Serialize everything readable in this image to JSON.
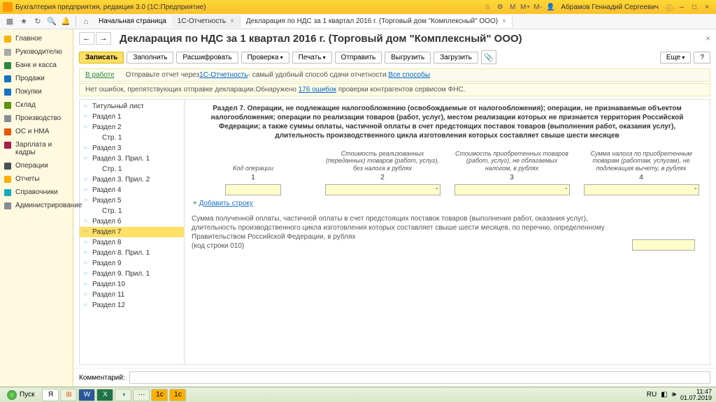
{
  "titlebar": {
    "title": "Бухгалтерия предприятия, редакция 3.0  (1С:Предприятие)",
    "user": "Абрамов Геннадий Сергеевич"
  },
  "tabs": {
    "home": "Начальная страница",
    "t1": "1С-Отчетность",
    "t2": "Декларация по НДС за 1 квартал 2016 г. (Торговый дом \"Комплексный\" ООО)"
  },
  "leftnav": [
    "Главное",
    "Руководителю",
    "Банк и касса",
    "Продажи",
    "Покупки",
    "Склад",
    "Производство",
    "ОС и НМА",
    "Зарплата и кадры",
    "Операции",
    "Отчеты",
    "Справочники",
    "Администрирование"
  ],
  "page": {
    "title": "Декларация по НДС за 1 квартал 2016 г. (Торговый дом \"Комплексный\" ООО)",
    "close": "×"
  },
  "actions": {
    "write": "Записать",
    "fill": "Заполнить",
    "decode": "Расшифровать",
    "check": "Проверка",
    "print": "Печать",
    "send": "Отправить",
    "export": "Выгрузить",
    "import": "Загрузить",
    "more": "Еще",
    "help": "?"
  },
  "notice1": {
    "status": "В работе",
    "text1": "Отправьте отчет через ",
    "link1": "1С-Отчетность",
    "text2": " - самый удобный способ сдачи отчетности. ",
    "link2": "Все способы"
  },
  "notice2": {
    "text1": "Нет ошибок, препятствующих отправке декларации.Обнаружено ",
    "link": "176 ошибок",
    "text2": " проверки контрагентов сервисом ФНС."
  },
  "tree": [
    {
      "l": "Титульный лист"
    },
    {
      "l": "Раздел 1"
    },
    {
      "l": "Раздел 2"
    },
    {
      "l": "Стр. 1",
      "i": 1
    },
    {
      "l": "Раздел 3"
    },
    {
      "l": "Раздел 3. Прил. 1"
    },
    {
      "l": "Стр. 1",
      "i": 1
    },
    {
      "l": "Раздел 3. Прил. 2"
    },
    {
      "l": "Раздел 4"
    },
    {
      "l": "Раздел 5"
    },
    {
      "l": "Стр. 1",
      "i": 1
    },
    {
      "l": "Раздел 6"
    },
    {
      "l": "Раздел 7",
      "sel": 1
    },
    {
      "l": "Раздел 8"
    },
    {
      "l": "Раздел 8. Прил. 1"
    },
    {
      "l": "Раздел 9"
    },
    {
      "l": "Раздел 9. Прил. 1"
    },
    {
      "l": "Раздел 10"
    },
    {
      "l": "Раздел 11"
    },
    {
      "l": "Раздел 12"
    }
  ],
  "section": {
    "title": "Раздел 7. Операции, не подлежащие налогообложению (освобождаемые от налогообложения); операции, не признаваемые объектом налогообложения; операции по реализации товаров (работ, услуг), местом реализации которых не признается территория Российской Федерации; а также суммы оплаты, частичной оплаты в счет предстоящих поставок товаров (выполнения работ, оказания услуг), длительность производственного цикла изготовления которых составляет свыше шести месяцев",
    "cols": [
      {
        "h": "Код операции",
        "n": "1"
      },
      {
        "h": "Стоимость реализованных (переданных) товаров (работ, услуг), без налога в рублях",
        "n": "2",
        "v": "-"
      },
      {
        "h": "Стоимость приобретенных товаров (работ, услуг), не облагаемых налогом, в рублях",
        "n": "3",
        "v": "-"
      },
      {
        "h": "Сумма налога по приобретенным товарам (работам, услугам), не подлежащая вычету, в рублях",
        "n": "4",
        "v": "-"
      }
    ],
    "add": "Добавить строку",
    "desc": "Сумма полученной оплаты, частичной оплаты в счет предстоящих поставок товаров (выполнения работ, оказания услуг), длительность производственного цикла изготовления которых составляет свыше шести месяцев, по перечню, определенному Правительством Российской Федерации, в рублях\n(код строки 010)"
  },
  "comment": {
    "label": "Комментарий:"
  },
  "taskbar": {
    "start": "Пуск",
    "lang": "RU",
    "time": "11:47",
    "date": "01.07.2019"
  }
}
